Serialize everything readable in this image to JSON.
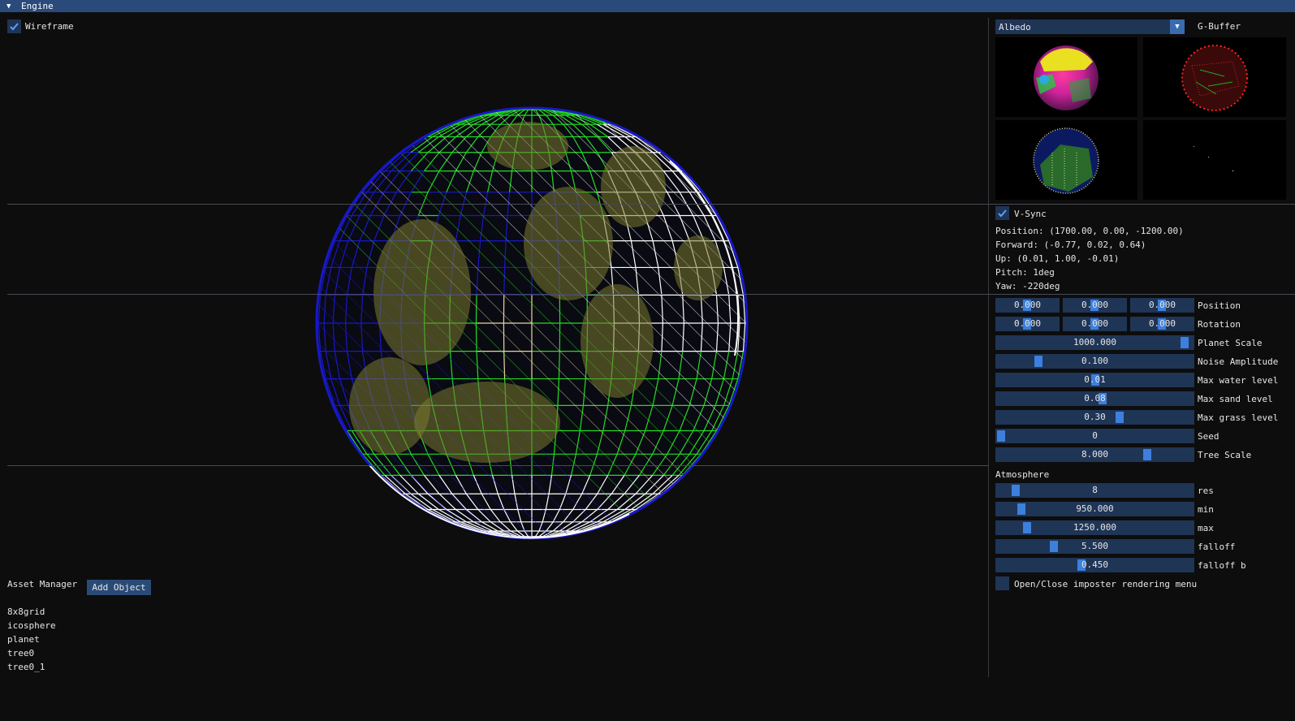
{
  "window": {
    "title": "Engine"
  },
  "viewport": {
    "wireframe_label": "Wireframe"
  },
  "asset_manager": {
    "title": "Asset Manager",
    "add_button": "Add Object",
    "items": [
      "8x8grid",
      "icosphere",
      "planet",
      "tree0",
      "tree0_1"
    ]
  },
  "gbuffer": {
    "selected": "Albedo",
    "label": "G-Buffer"
  },
  "camera": {
    "vsync_label": "V-Sync",
    "position": "Position: (1700.00, 0.00, -1200.00)",
    "forward": "Forward: (-0.77, 0.02, 0.64)",
    "up": "Up: (0.01, 1.00, -0.01)",
    "pitch": "Pitch: 1deg",
    "yaw": "Yaw: -220deg"
  },
  "transform": {
    "position": {
      "label": "Position",
      "values": [
        "0.000",
        "0.000",
        "0.000"
      ]
    },
    "rotation": {
      "label": "Rotation",
      "values": [
        "0.000",
        "0.000",
        "0.000"
      ]
    }
  },
  "planet_sliders": [
    {
      "label": "Planet Scale",
      "value": "1000.000",
      "fraction": 0.98
    },
    {
      "label": "Noise Amplitude",
      "value": "0.100",
      "fraction": 0.2
    },
    {
      "label": "Max water level",
      "value": "0.01",
      "fraction": 0.5
    },
    {
      "label": "Max sand level",
      "value": "0.08",
      "fraction": 0.54
    },
    {
      "label": "Max grass level",
      "value": "0.30",
      "fraction": 0.63
    },
    {
      "label": "Seed",
      "value": "0",
      "fraction": 0.0
    },
    {
      "label": "Tree Scale",
      "value": "8.000",
      "fraction": 0.78
    }
  ],
  "atmosphere": {
    "title": "Atmosphere",
    "sliders": [
      {
        "label": "res",
        "value": "8",
        "fraction": 0.08
      },
      {
        "label": "min",
        "value": "950.000",
        "fraction": 0.11
      },
      {
        "label": "max",
        "value": "1250.000",
        "fraction": 0.14
      },
      {
        "label": "falloff",
        "value": "5.500",
        "fraction": 0.28
      },
      {
        "label": "falloff b",
        "value": "0.450",
        "fraction": 0.43
      }
    ],
    "imposter_label": "Open/Close imposter rendering menu"
  },
  "colors": {
    "accent": "#3d7fdc",
    "frame": "#1f3556",
    "title_bar": "#294a7a",
    "wire_blue": "#1818c8",
    "wire_green": "#22dd22",
    "wire_white": "#ffffff",
    "wire_sand": "#e8d8a0"
  }
}
